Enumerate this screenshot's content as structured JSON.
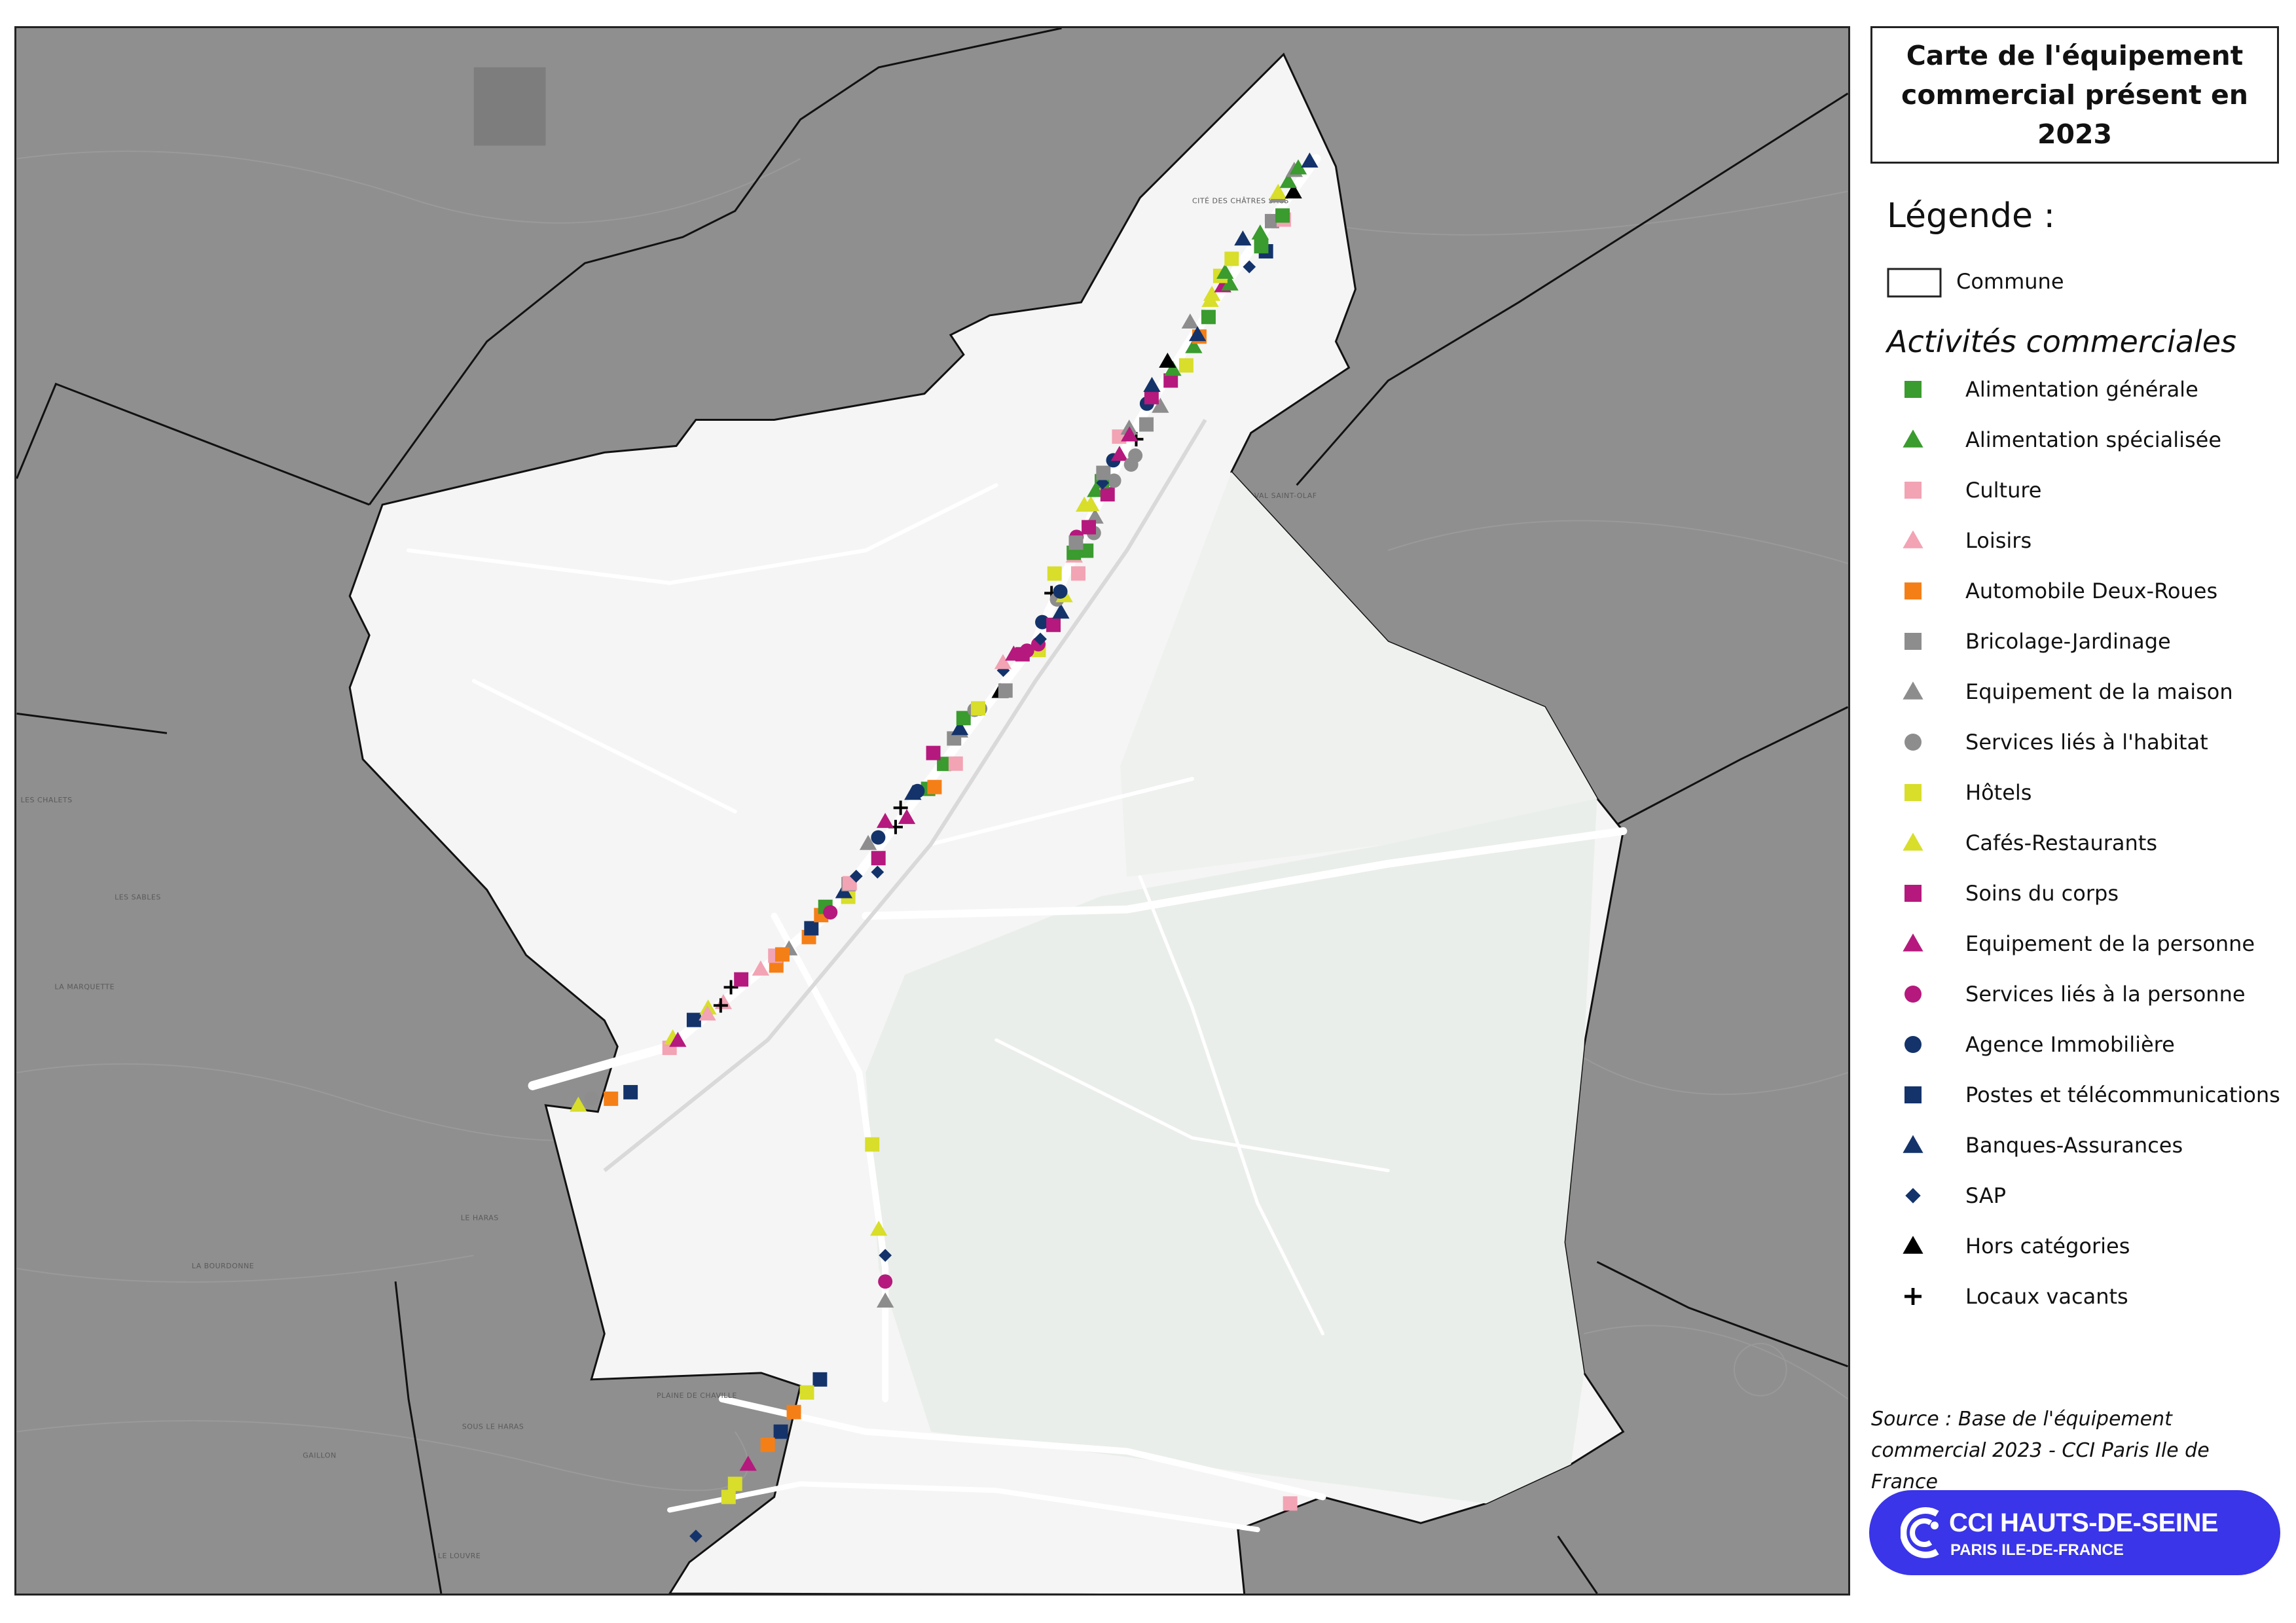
{
  "title": "Carte de l'équipement commercial présent en 2023",
  "legend": {
    "heading": "Légende :",
    "commune_label": "Commune",
    "activities_heading": "Activités commerciales",
    "items": [
      {
        "label": "Alimentation générale",
        "shape": "square",
        "color": "#3a9b2e"
      },
      {
        "label": "Alimentation spécialisée",
        "shape": "triangle",
        "color": "#3a9b2e"
      },
      {
        "label": "Culture",
        "shape": "square",
        "color": "#f2a3b4"
      },
      {
        "label": "Loisirs",
        "shape": "triangle",
        "color": "#f2a3b4"
      },
      {
        "label": "Automobile Deux-Roues",
        "shape": "square",
        "color": "#f57f17"
      },
      {
        "label": "Bricolage-Jardinage",
        "shape": "square",
        "color": "#8d8d8d"
      },
      {
        "label": "Equipement de la maison",
        "shape": "triangle",
        "color": "#8d8d8d"
      },
      {
        "label": "Services liés à l'habitat",
        "shape": "circle",
        "color": "#8d8d8d"
      },
      {
        "label": "Hôtels",
        "shape": "square",
        "color": "#d8de2a"
      },
      {
        "label": "Cafés-Restaurants",
        "shape": "triangle",
        "color": "#d8de2a"
      },
      {
        "label": "Soins du corps",
        "shape": "square",
        "color": "#b5197d"
      },
      {
        "label": "Equipement de la personne",
        "shape": "triangle",
        "color": "#b5197d"
      },
      {
        "label": "Services liés à la personne",
        "shape": "circle",
        "color": "#b5197d"
      },
      {
        "label": "Agence Immobilière",
        "shape": "circle",
        "color": "#14336b"
      },
      {
        "label": "Postes et télécommunications",
        "shape": "square",
        "color": "#14336b"
      },
      {
        "label": "Banques-Assurances",
        "shape": "triangle",
        "color": "#14336b"
      },
      {
        "label": "SAP",
        "shape": "diamond",
        "color": "#14336b"
      },
      {
        "label": "Hors catégories",
        "shape": "triangle",
        "color": "#000000"
      },
      {
        "label": "Locaux vacants",
        "shape": "plus",
        "color": "#000000"
      }
    ]
  },
  "source": "Source : Base de l'équipement commercial 2023 - CCI Paris Ile de France",
  "logo": {
    "name": "CCI HAUTS-DE-SEINE",
    "sub": "PARIS ILE-DE-FRANCE",
    "color": "#3a35e8"
  },
  "map": {
    "place_labels": [
      "CITÉ DES CHÂTRES SACS",
      "VAL SAINT-OLAF",
      "LES CHALETS",
      "LES SABLES",
      "LA MARQUETTE",
      "LE HARAS",
      "LA BOURDONNE",
      "PLAINE DE CHAVILLE",
      "SOUS LE HARAS",
      "GAILLON",
      "LE LOUVRE"
    ],
    "colors": {
      "outside": "#8f8f8f",
      "commune_fill": "#f4f5f4",
      "green_area": "#eaeeea",
      "roads": "#ffffff",
      "boundary": "#111111"
    }
  }
}
